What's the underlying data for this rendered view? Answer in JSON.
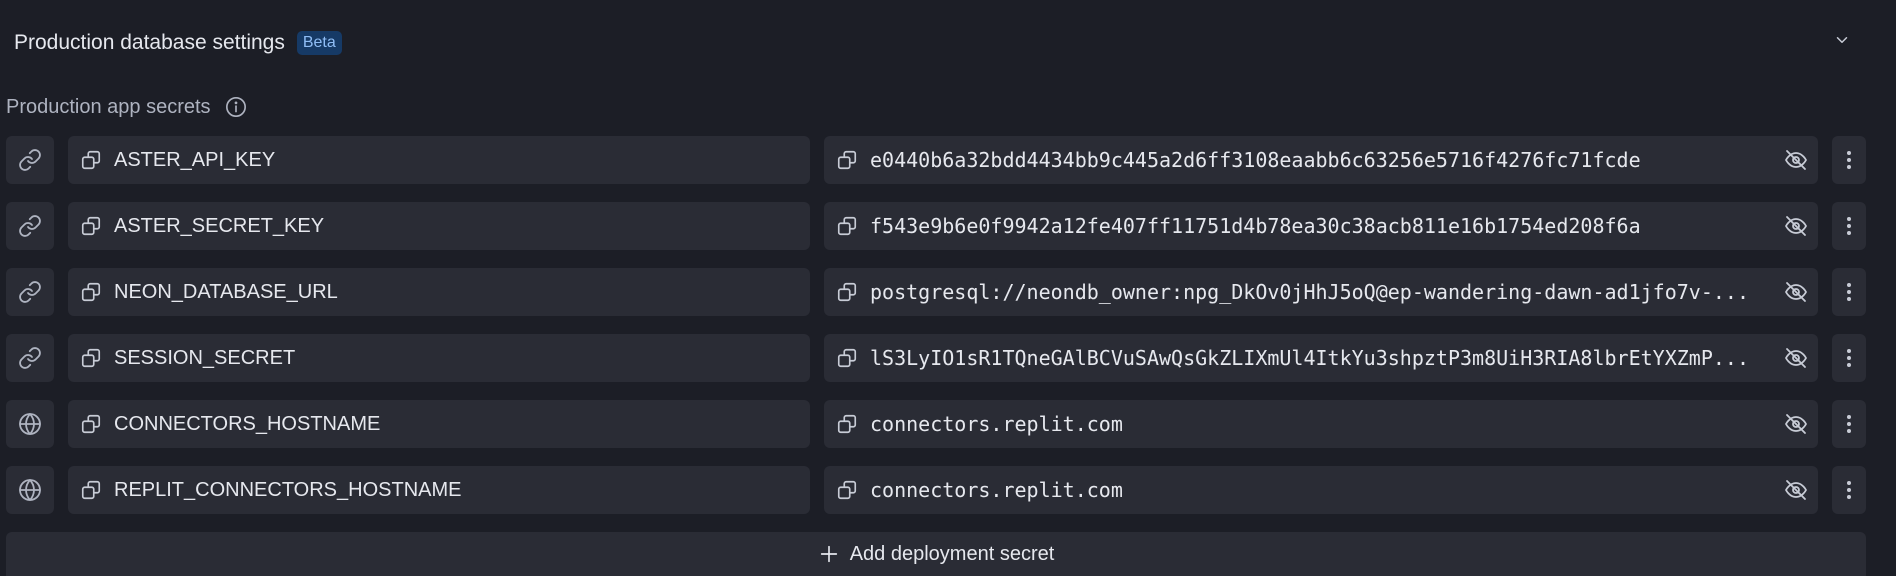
{
  "header": {
    "title": "Production database settings",
    "badge": "Beta",
    "toggle_icon": "chevron-down-icon"
  },
  "secrets_section": {
    "label": "Production app secrets",
    "info_icon": "info-icon"
  },
  "secrets": [
    {
      "type_icon": "link-icon",
      "key": "ASTER_API_KEY",
      "value": "e0440b6a32bdd4434bb9c445a2d6ff3108eaabb6c63256e5716f4276fc71fcde"
    },
    {
      "type_icon": "link-icon",
      "key": "ASTER_SECRET_KEY",
      "value": "f543e9b6e0f9942a12fe407ff11751d4b78ea30c38acb811e16b1754ed208f6a"
    },
    {
      "type_icon": "link-icon",
      "key": "NEON_DATABASE_URL",
      "value": "postgresql://neondb_owner:npg_DkOv0jHhJ5oQ@ep-wandering-dawn-ad1jfo7v-..."
    },
    {
      "type_icon": "link-icon",
      "key": "SESSION_SECRET",
      "value": "lS3LyIO1sR1TQneGAlBCVuSAwQsGkZLIXmUl4ItkYu3shpztP3m8UiH3RIA8lbrEtYXZmP..."
    },
    {
      "type_icon": "globe-icon",
      "key": "CONNECTORS_HOSTNAME",
      "value": "connectors.replit.com"
    },
    {
      "type_icon": "globe-icon",
      "key": "REPLIT_CONNECTORS_HOSTNAME",
      "value": "connectors.replit.com"
    }
  ],
  "add_button": {
    "label": "Add deployment secret",
    "icon": "plus-icon"
  },
  "colors": {
    "background": "#1c1e26",
    "field": "#2a2c35",
    "badge_bg": "#163a66",
    "badge_text": "#8fbdf5"
  }
}
